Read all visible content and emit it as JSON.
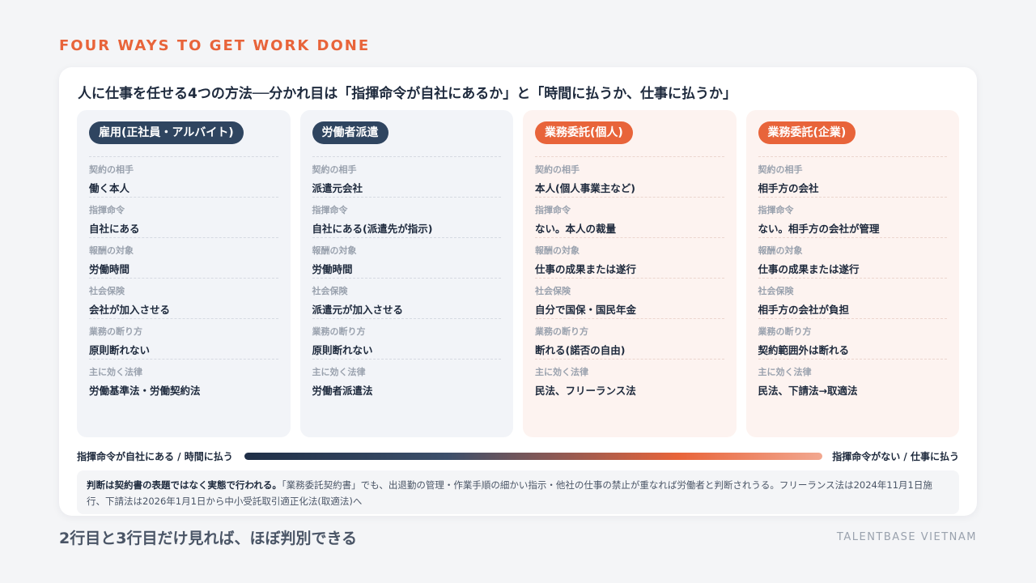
{
  "eyebrow": "FOUR WAYS TO GET WORK DONE",
  "headline": "人に仕事を任せる4つの方法──分かれ目は「指揮命令が自社にあるか」と「時間に払うか、仕事に払うか」",
  "row_labels": [
    "契約の相手",
    "指揮命令",
    "報酬の対象",
    "社会保険",
    "業務の断り方",
    "主に効く法律"
  ],
  "columns": [
    {
      "title": "雇用(正社員・アルバイト)",
      "tone": "dark",
      "values": [
        "働く本人",
        "自社にある",
        "労働時間",
        "会社が加入させる",
        "原則断れない",
        "労働基準法・労働契約法"
      ]
    },
    {
      "title": "労働者派遣",
      "tone": "dark",
      "values": [
        "派遣元会社",
        "自社にある(派遣先が指示)",
        "労働時間",
        "派遣元が加入させる",
        "原則断れない",
        "労働者派遣法"
      ]
    },
    {
      "title": "業務委託(個人)",
      "tone": "orange",
      "values": [
        "本人(個人事業主など)",
        "ない。本人の裁量",
        "仕事の成果または遂行",
        "自分で国保・国民年金",
        "断れる(諾否の自由)",
        "民法、フリーランス法"
      ]
    },
    {
      "title": "業務委託(企業)",
      "tone": "orange",
      "values": [
        "相手方の会社",
        "ない。相手方の会社が管理",
        "仕事の成果または遂行",
        "相手方の会社が負担",
        "契約範囲外は断れる",
        "民法、下請法→取適法"
      ]
    }
  ],
  "scale": {
    "left": "指揮命令が自社にある / 時間に払う",
    "right": "指揮命令がない / 仕事に払う"
  },
  "note": {
    "bold": "判断は契約書の表題ではなく実態で行われる。",
    "text": "「業務委託契約書」でも、出退勤の管理・作業手順の細かい指示・他社の仕事の禁止が重なれば労働者と判断されうる。フリーランス法は2024年11月1日施行、下請法は2026年1月1日から中小受託取引適正化法(取適法)へ"
  },
  "takeaway": "2行目と3行目だけ見れば、ほぼ判別できる",
  "brand": "TALENTBASE VIETNAM",
  "colors": {
    "accent": "#e8643a",
    "navy": "#2f4560"
  }
}
